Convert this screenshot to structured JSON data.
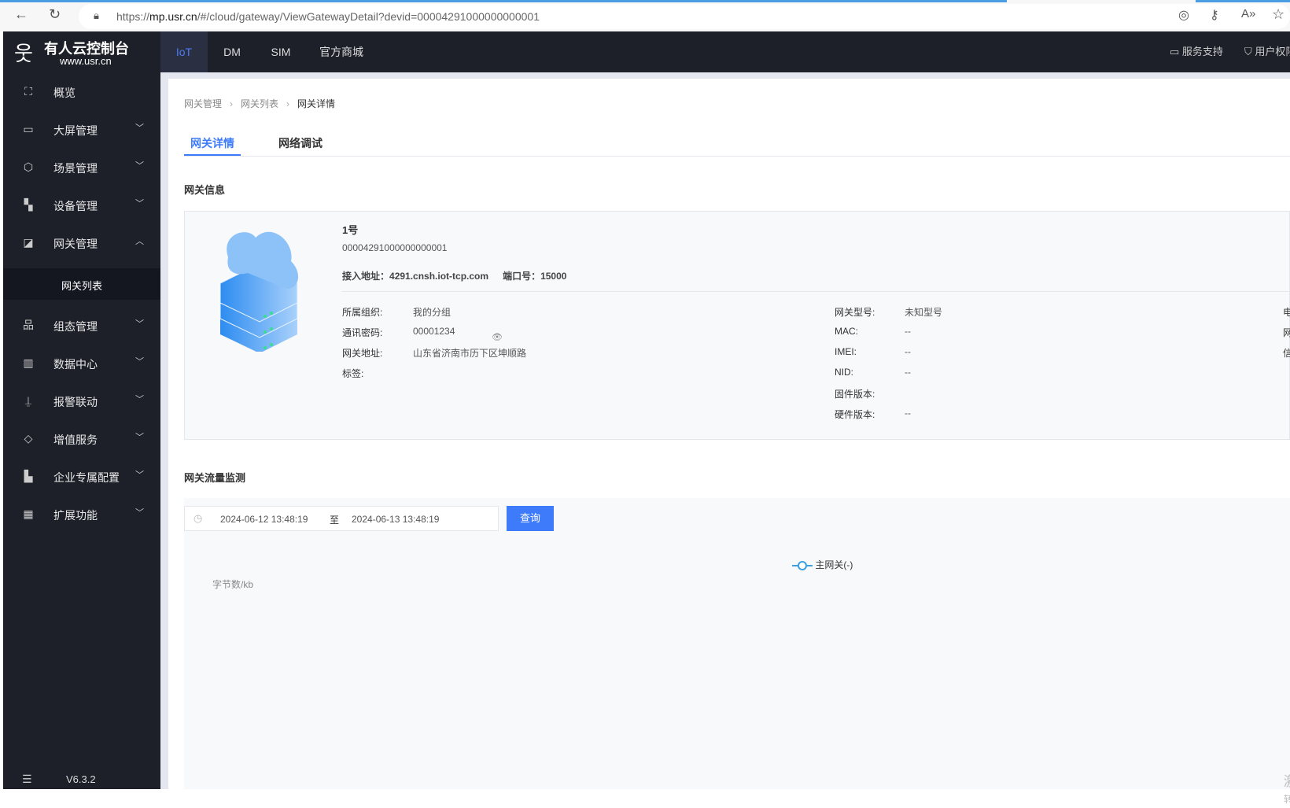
{
  "browser": {
    "url_prefix": "https://",
    "url_host": "mp.usr.cn",
    "url_path": "/#/cloud/gateway/ViewGatewayDetail?devid=00004291000000000001"
  },
  "brand": {
    "title": "有人云控制台",
    "site": "www.usr.cn"
  },
  "header": {
    "tabs": [
      "IoT",
      "DM",
      "SIM",
      "官方商城"
    ],
    "active": "IoT",
    "support": "服务支持",
    "rights": "用户权限"
  },
  "sidebar": {
    "items": [
      {
        "label": "概览",
        "icon": "overview-icon"
      },
      {
        "label": "大屏管理",
        "icon": "screen-icon"
      },
      {
        "label": "场景管理",
        "icon": "cube-icon"
      },
      {
        "label": "设备管理",
        "icon": "device-icon"
      },
      {
        "label": "网关管理",
        "icon": "gateway-icon",
        "expanded": true
      },
      {
        "label": "组态管理",
        "icon": "topology-icon"
      },
      {
        "label": "数据中心",
        "icon": "chart-icon"
      },
      {
        "label": "报警联动",
        "icon": "alarm-icon"
      },
      {
        "label": "增值服务",
        "icon": "diamond-icon"
      },
      {
        "label": "企业专属配置",
        "icon": "enterprise-icon"
      },
      {
        "label": "扩展功能",
        "icon": "grid-icon"
      }
    ],
    "subitem": "网关列表",
    "version": "V6.3.2"
  },
  "breadcrumb": [
    "网关管理",
    "网关列表",
    "网关详情"
  ],
  "tabs": [
    "网关详情",
    "网络调试"
  ],
  "info": {
    "section": "网关信息",
    "name": "1号",
    "id": "00004291000000000001",
    "addr_label": "接入地址：",
    "addr": "4291.cnsh.iot-tcp.com",
    "port_label": "端口号：",
    "port": "15000",
    "col1": [
      {
        "k": "所属组织:",
        "v": "我的分组"
      },
      {
        "k": "通讯密码:",
        "v": "00001234"
      },
      {
        "k": "网关地址:",
        "v": "山东省济南市历下区坤顺路"
      },
      {
        "k": "标签:",
        "v": ""
      }
    ],
    "col2": [
      {
        "k": "网关型号:",
        "v": "未知型号"
      },
      {
        "k": "MAC:",
        "v": "--"
      },
      {
        "k": "IMEI:",
        "v": "--"
      },
      {
        "k": "NID:",
        "v": "--"
      },
      {
        "k": "固件版本:",
        "v": ""
      },
      {
        "k": "硬件版本:",
        "v": "--"
      }
    ],
    "col3": [
      "电",
      "网",
      "信"
    ]
  },
  "traffic": {
    "section": "网关流量监测",
    "start": "2024-06-12 13:48:19",
    "sep": "至",
    "end": "2024-06-13 13:48:19",
    "query": "查询",
    "legend": "主网关(-)",
    "ylabel": "字节数/kb"
  },
  "watermark": [
    "激",
    "转"
  ],
  "colors": {
    "accent": "#3e7bfa",
    "sidebar": "#1d2029"
  }
}
